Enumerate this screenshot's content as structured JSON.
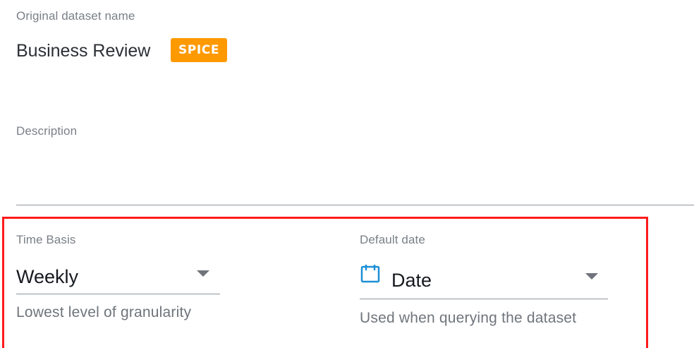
{
  "dataset": {
    "original_name_label": "Original dataset name",
    "name": "Business Review",
    "storage_badge": "SPICE",
    "description_label": "Description",
    "description_value": ""
  },
  "time_basis": {
    "label": "Time Basis",
    "value": "Weekly",
    "helper": "Lowest level of granularity"
  },
  "default_date": {
    "label": "Default date",
    "value": "Date",
    "helper": "Used when querying the dataset",
    "icon": "calendar-icon"
  },
  "colors": {
    "badge": "#ff9900",
    "highlight": "#ff1a1a",
    "calendar": "#1d8fd6"
  }
}
